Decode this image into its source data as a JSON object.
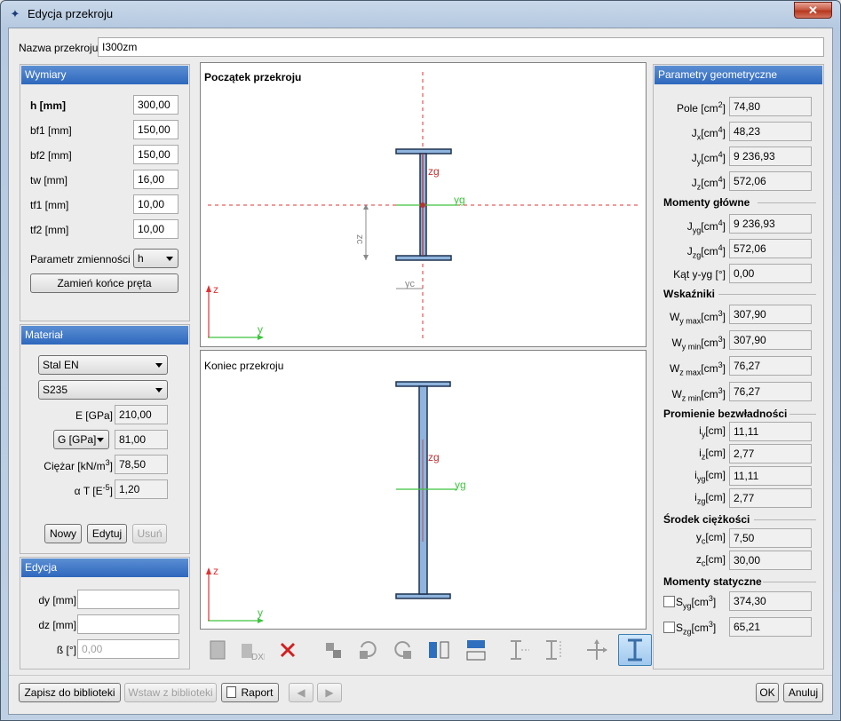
{
  "window": {
    "title": "Edycja przekroju",
    "close_label": "✕"
  },
  "name_row": {
    "label": "Nazwa przekroju",
    "value": "I300zm"
  },
  "wymiary": {
    "header": "Wymiary",
    "rows": [
      {
        "label": "h [mm]",
        "value": "300,00"
      },
      {
        "label": "bf1 [mm]",
        "value": "150,00"
      },
      {
        "label": "bf2 [mm]",
        "value": "150,00"
      },
      {
        "label": "tw [mm]",
        "value": "16,00"
      },
      {
        "label": "tf1 [mm]",
        "value": "10,00"
      },
      {
        "label": "tf2 [mm]",
        "value": "10,00"
      }
    ],
    "param_label": "Parametr zmienności",
    "param_value": "h",
    "swap_button": "Zamień końce pręta"
  },
  "material": {
    "header": "Materiał",
    "grade": "Stal EN",
    "steel": "S235",
    "e_label": "E [GPa]",
    "e_value": "210,00",
    "g_select": "G [GPa]",
    "g_value": "81,00",
    "weight_label": "Ciężar [kN/m",
    "weight_sup": "3",
    "weight_close": "]",
    "weight_value": "78,50",
    "alpha_label": "α T [E",
    "alpha_sup": "-5",
    "alpha_close": "]",
    "alpha_value": "1,20",
    "new_button": "Nowy",
    "edit_button": "Edytuj",
    "delete_button": "Usuń"
  },
  "edycja": {
    "header": "Edycja",
    "dy_label": "dy [mm]",
    "dy_value": "",
    "dz_label": "dz [mm]",
    "dz_value": "",
    "beta_label": "ß [°]",
    "beta_placeholder": "0,00"
  },
  "view_top": {
    "title": "Początek przekroju",
    "zg": "zg",
    "yg": "yg",
    "zc": "zc",
    "yc": "yc",
    "z": "z",
    "y": "y"
  },
  "view_bottom": {
    "title": "Koniec przekroju",
    "zg": "zg",
    "yg": "yg",
    "z": "z",
    "y": "y"
  },
  "toolbar": {
    "icons": [
      "import-section-icon",
      "import-dxf-icon",
      "delete-icon",
      "connect-icon",
      "rotate-left-icon",
      "rotate-right-icon",
      "mirror-horizontal-icon",
      "mirror-vertical-icon",
      "flange-align-icon",
      "flange-height-icon",
      "move-icon",
      "section-view-icon"
    ],
    "dxf_text": "DXF"
  },
  "geom": {
    "header": "Parametry geometryczne",
    "rows1": [
      {
        "label": "Pole [cm",
        "sup": "2",
        "sub": "",
        "tail": "]",
        "value": "74,80"
      },
      {
        "label": "J",
        "sub": "x",
        "sup": "4",
        "tail": "[cm",
        "value": "48,23"
      },
      {
        "label": "J",
        "sub": "y",
        "sup": "4",
        "tail": "[cm",
        "value": "9 236,93"
      },
      {
        "label": "J",
        "sub": "z",
        "sup": "4",
        "tail": "[cm",
        "value": "572,06"
      }
    ],
    "momenty_glowne": "Momenty główne",
    "rows2": [
      {
        "label": "J",
        "sub": "yg",
        "sup": "4",
        "tail": "[cm",
        "value": "9 236,93"
      },
      {
        "label": "J",
        "sub": "zg",
        "sup": "4",
        "tail": "[cm",
        "value": "572,06"
      }
    ],
    "kat_label": "Kąt y-yg [°]",
    "kat_value": "0,00",
    "wskazniki": "Wskaźniki",
    "rows3": [
      {
        "label": "W",
        "sub": "y max",
        "sup": "3",
        "tail": "[cm",
        "value": "307,90"
      },
      {
        "label": "W",
        "sub": "y min",
        "sup": "3",
        "tail": "[cm",
        "value": "307,90"
      },
      {
        "label": "W",
        "sub": "z max",
        "sup": "3",
        "tail": "[cm",
        "value": "76,27"
      },
      {
        "label": "W",
        "sub": "z min",
        "sup": "3",
        "tail": "[cm",
        "value": "76,27"
      }
    ],
    "promienie": "Promienie bezwładności",
    "rows4": [
      {
        "label": "i",
        "sub": "y",
        "tail": "[cm]",
        "value": "11,11"
      },
      {
        "label": "i",
        "sub": "z",
        "tail": "[cm]",
        "value": "2,77"
      },
      {
        "label": "i",
        "sub": "yg",
        "tail": "[cm]",
        "value": "11,11"
      },
      {
        "label": "i",
        "sub": "zg",
        "tail": "[cm]",
        "value": "2,77"
      }
    ],
    "srodek": "Środek ciężkości",
    "rows5": [
      {
        "label": "y",
        "sub": "c",
        "tail": "[cm]",
        "value": "7,50"
      },
      {
        "label": "z",
        "sub": "c",
        "tail": "[cm]",
        "value": "30,00"
      }
    ],
    "statyczne": "Momenty statyczne",
    "rows6": [
      {
        "label": "S",
        "sub": "yg",
        "sup": "3",
        "tail": "[cm",
        "value": "374,30"
      },
      {
        "label": "S",
        "sub": "zg",
        "sup": "3",
        "tail": "[cm",
        "value": "65,21"
      }
    ]
  },
  "footer": {
    "save_lib": "Zapisz do biblioteki",
    "insert_lib": "Wstaw z biblioteki",
    "report": "Raport",
    "ok": "OK",
    "cancel": "Anuluj"
  }
}
